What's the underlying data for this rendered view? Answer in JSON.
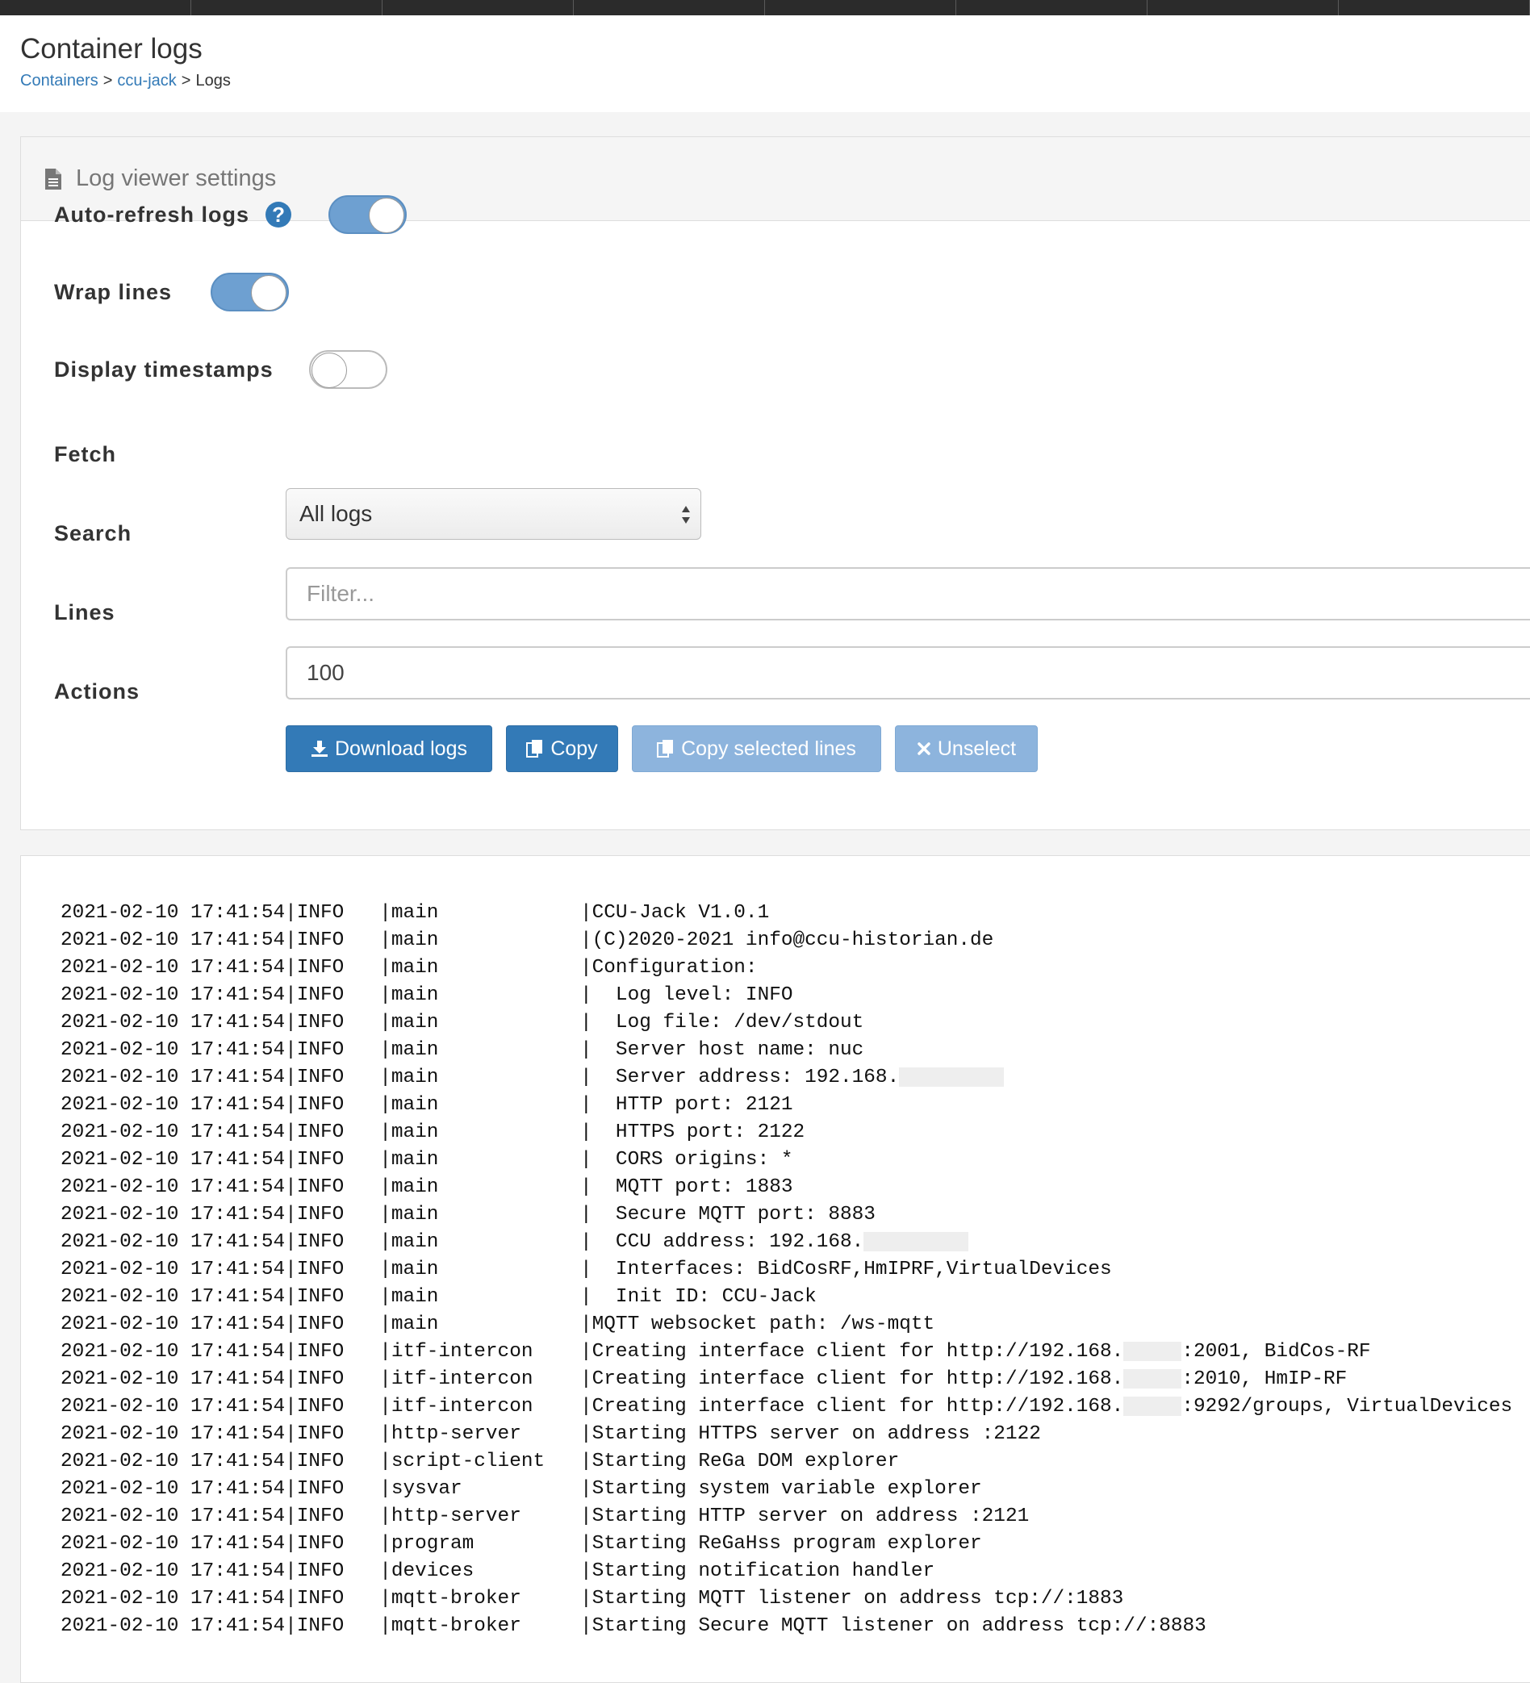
{
  "header": {
    "title": "Container logs",
    "breadcrumb": [
      "Containers",
      "ccu-jack",
      "Logs"
    ],
    "separator": ">"
  },
  "settings": {
    "heading": "Log viewer settings",
    "auto_refresh_label": "Auto-refresh logs",
    "auto_refresh_on": true,
    "help_glyph": "?",
    "wrap_lines_label": "Wrap lines",
    "wrap_lines_on": true,
    "display_timestamps_label": "Display timestamps",
    "display_timestamps_on": false,
    "fetch_label": "Fetch",
    "fetch_value": "All logs",
    "search_label": "Search",
    "search_placeholder": "Filter...",
    "lines_label": "Lines",
    "lines_value": "100",
    "actions_label": "Actions"
  },
  "actions": {
    "download": "Download logs",
    "copy": "Copy",
    "copy_selected": "Copy selected lines",
    "unselect": "Unselect"
  },
  "colors": {
    "primary": "#337ab7",
    "disabled": "#8db4dd",
    "toggle_on": "#6ea0d1"
  },
  "log": {
    "lines": [
      {
        "prefix": "2021-02-10 17:41:54|INFO   |main            |CCU-Jack V1.0.1"
      },
      {
        "prefix": "2021-02-10 17:41:54|INFO   |main            |(C)2020-2021 info@ccu-historian.de"
      },
      {
        "prefix": "2021-02-10 17:41:54|INFO   |main            |Configuration:"
      },
      {
        "prefix": "2021-02-10 17:41:54|INFO   |main            |  Log level: INFO"
      },
      {
        "prefix": "2021-02-10 17:41:54|INFO   |main            |  Log file: /dev/stdout"
      },
      {
        "prefix": "2021-02-10 17:41:54|INFO   |main            |  Server host name: nuc"
      },
      {
        "prefix": "2021-02-10 17:41:54|INFO   |main            |  Server address: 192.168.",
        "redact": 9
      },
      {
        "prefix": "2021-02-10 17:41:54|INFO   |main            |  HTTP port: 2121"
      },
      {
        "prefix": "2021-02-10 17:41:54|INFO   |main            |  HTTPS port: 2122"
      },
      {
        "prefix": "2021-02-10 17:41:54|INFO   |main            |  CORS origins: *"
      },
      {
        "prefix": "2021-02-10 17:41:54|INFO   |main            |  MQTT port: 1883"
      },
      {
        "prefix": "2021-02-10 17:41:54|INFO   |main            |  Secure MQTT port: 8883"
      },
      {
        "prefix": "2021-02-10 17:41:54|INFO   |main            |  CCU address: 192.168.",
        "redact": 9
      },
      {
        "prefix": "2021-02-10 17:41:54|INFO   |main            |  Interfaces: BidCosRF,HmIPRF,VirtualDevices"
      },
      {
        "prefix": "2021-02-10 17:41:54|INFO   |main            |  Init ID: CCU-Jack"
      },
      {
        "prefix": "2021-02-10 17:41:54|INFO   |main            |MQTT websocket path: /ws-mqtt"
      },
      {
        "prefix": "2021-02-10 17:41:54|INFO   |itf-intercon    |Creating interface client for http://192.168.",
        "redact": 5,
        "suffix": ":2001, BidCos-RF"
      },
      {
        "prefix": "2021-02-10 17:41:54|INFO   |itf-intercon    |Creating interface client for http://192.168.",
        "redact": 5,
        "suffix": ":2010, HmIP-RF"
      },
      {
        "prefix": "2021-02-10 17:41:54|INFO   |itf-intercon    |Creating interface client for http://192.168.",
        "redact": 5,
        "suffix": ":9292/groups, VirtualDevices"
      },
      {
        "prefix": "2021-02-10 17:41:54|INFO   |http-server     |Starting HTTPS server on address :2122"
      },
      {
        "prefix": "2021-02-10 17:41:54|INFO   |script-client   |Starting ReGa DOM explorer"
      },
      {
        "prefix": "2021-02-10 17:41:54|INFO   |sysvar          |Starting system variable explorer"
      },
      {
        "prefix": "2021-02-10 17:41:54|INFO   |http-server     |Starting HTTP server on address :2121"
      },
      {
        "prefix": "2021-02-10 17:41:54|INFO   |program         |Starting ReGaHss program explorer"
      },
      {
        "prefix": "2021-02-10 17:41:54|INFO   |devices         |Starting notification handler"
      },
      {
        "prefix": "2021-02-10 17:41:54|INFO   |mqtt-broker     |Starting MQTT listener on address tcp://:1883"
      },
      {
        "prefix": "2021-02-10 17:41:54|INFO   |mqtt-broker     |Starting Secure MQTT listener on address tcp://:8883"
      }
    ]
  }
}
